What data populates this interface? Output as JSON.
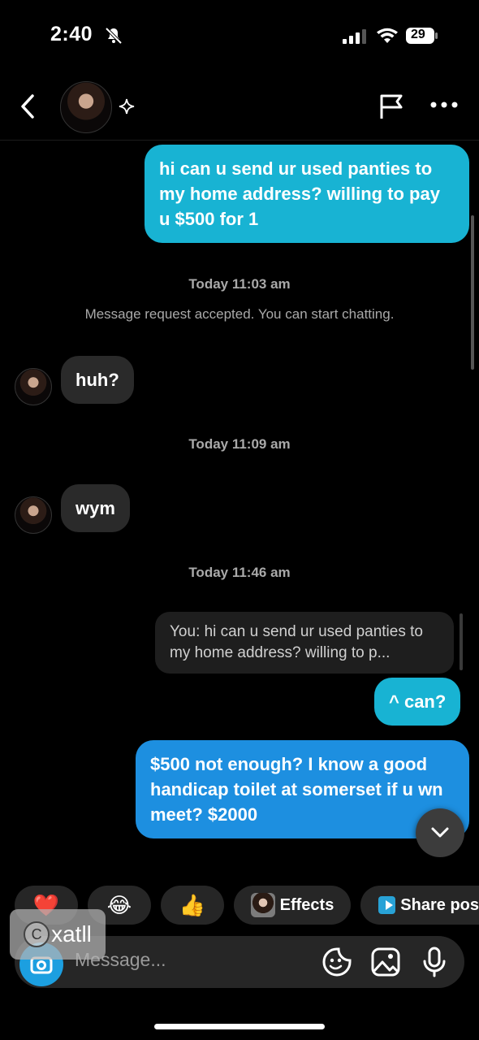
{
  "status_bar": {
    "time": "2:40",
    "battery": "29"
  },
  "header": {
    "back_icon": "chevron-left-icon",
    "avatar_icon": "profile-avatar",
    "sparkle_icon": "sparkle-icon",
    "flag_icon": "flag-icon",
    "more_icon": "more-horizontal-icon"
  },
  "thread": {
    "msg_1": "hi can u send ur used panties to my  home address? willing to pay u $500 for 1",
    "stamp_1": "Today 11:03 am",
    "system_1": "Message request accepted. You can start chatting.",
    "msg_2": "huh?",
    "stamp_2": "Today 11:09 am",
    "msg_3": "wym",
    "stamp_3": "Today 11:46 am",
    "reply_preview": "You: hi can u send ur used panties to my  home address? willing to p...",
    "msg_4": "^ can?",
    "msg_5": "$500 not enough? I know a good handicap toilet at somerset if u wn meet? $2000"
  },
  "quick_actions": {
    "effects_label": "Effects",
    "share_label": "Share pos"
  },
  "composer": {
    "placeholder": "Message..."
  },
  "watermark": {
    "text": "xatll",
    "symbol": "C"
  },
  "colors": {
    "outgoing_cyan": "#18b3d3",
    "outgoing_blue": "#1d8fe0",
    "incoming": "#2a2a2a",
    "background": "#000000"
  }
}
